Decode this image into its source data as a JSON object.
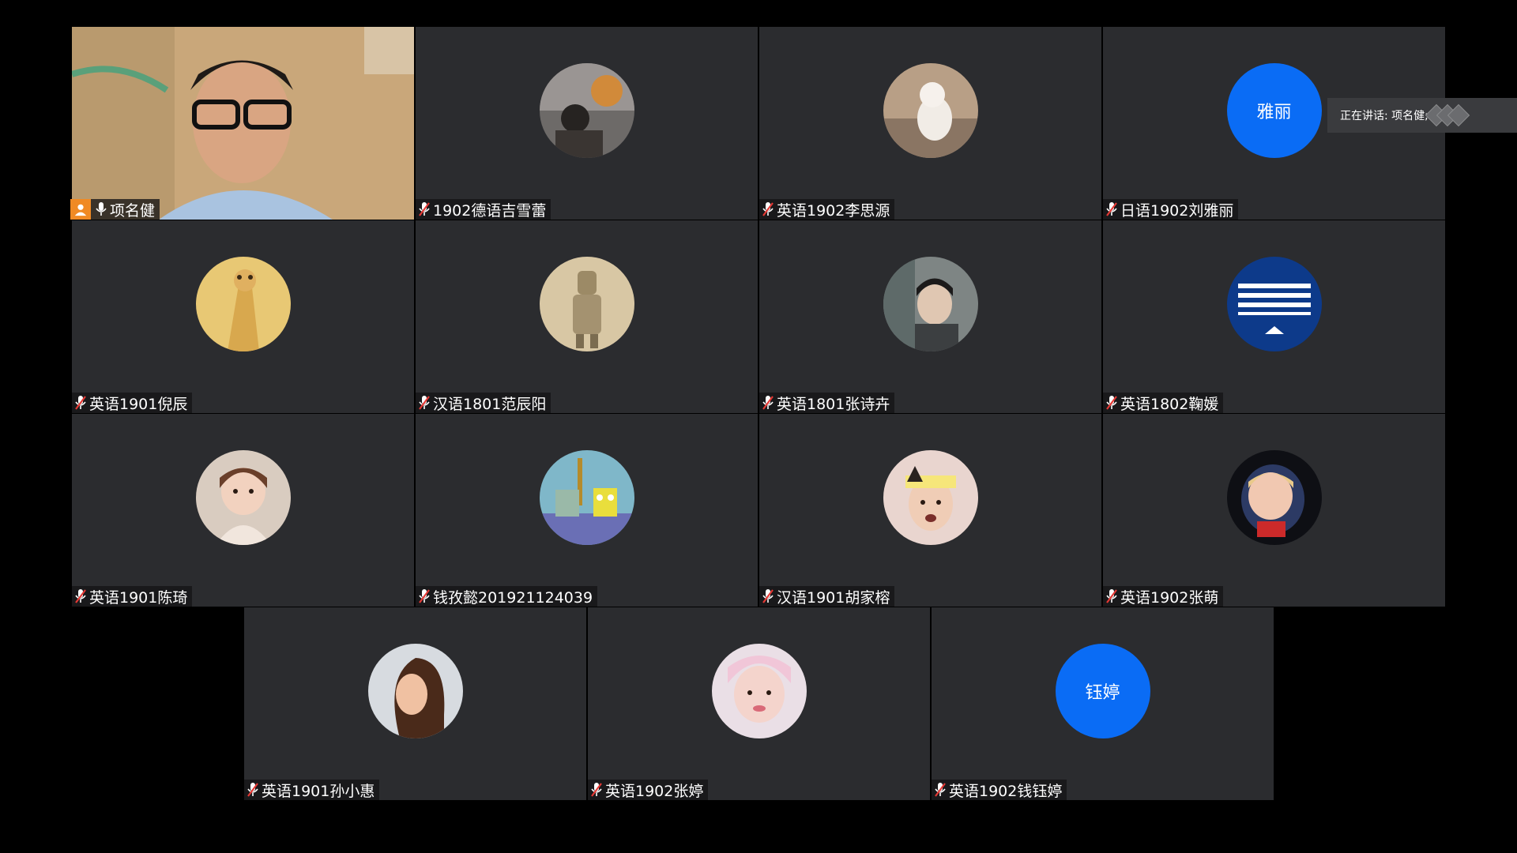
{
  "speaking": {
    "label": "正在讲话: 项名健;"
  },
  "host": {
    "name": "项名健"
  },
  "participants": [
    {
      "name": "1902德语吉雪蕾"
    },
    {
      "name": "英语1902李思源"
    },
    {
      "name": "日语1902刘雅丽",
      "initials": "雅丽"
    },
    {
      "name": "英语1901倪辰"
    },
    {
      "name": "汉语1801范辰阳"
    },
    {
      "name": "英语1801张诗卉"
    },
    {
      "name": "英语1802鞠媛"
    },
    {
      "name": "英语1901陈琦"
    },
    {
      "name": "钱孜懿201921124039"
    },
    {
      "name": "汉语1901胡家榕"
    },
    {
      "name": "英语1902张萌"
    },
    {
      "name": "英语1901孙小惠"
    },
    {
      "name": "英语1902张婷"
    },
    {
      "name": "英语1902钱钰婷",
      "initials": "钰婷"
    }
  ],
  "colors": {
    "tile": "#2b2c2f",
    "host_badge": "#f08a24",
    "initials_avatar": "#0a6cf5",
    "muted_mic": "#e53935"
  },
  "icons": {
    "muted": "mic-muted-icon",
    "mic": "mic-icon",
    "host": "host-icon"
  }
}
